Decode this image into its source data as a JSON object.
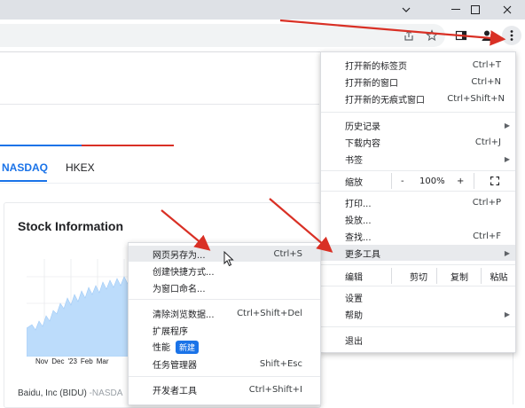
{
  "window": {
    "controls": [
      "chevron-down-icon",
      "minimize-icon",
      "maximize-icon",
      "close-icon"
    ]
  },
  "toolbar": {
    "icons": [
      "share-icon",
      "star-icon",
      "side-panel-icon",
      "profile-icon",
      "kebab-menu-icon"
    ]
  },
  "page": {
    "tabs": [
      {
        "label": "NASDAQ",
        "active": true
      },
      {
        "label": "HKEX",
        "active": false
      }
    ],
    "card_title": "Stock Information",
    "x_ticks": [
      "Nov",
      "Dec",
      "'23",
      "Feb",
      "Mar"
    ],
    "stock_name": "Baidu, Inc (BIDU)",
    "stock_exchange": "-NASDA"
  },
  "main_menu": {
    "items": [
      {
        "label": "打开新的标签页",
        "shortcut": "Ctrl+T"
      },
      {
        "label": "打开新的窗口",
        "shortcut": "Ctrl+N"
      },
      {
        "label": "打开新的无痕式窗口",
        "shortcut": "Ctrl+Shift+N"
      },
      {
        "label": "历史记录",
        "shortcut": ""
      },
      {
        "label": "下载内容",
        "shortcut": "Ctrl+J"
      },
      {
        "label": "书签",
        "shortcut": ""
      },
      {
        "label": "打印...",
        "shortcut": "Ctrl+P"
      },
      {
        "label": "投放...",
        "shortcut": ""
      },
      {
        "label": "查找...",
        "shortcut": "Ctrl+F"
      },
      {
        "label": "更多工具",
        "shortcut": ""
      },
      {
        "label": "设置",
        "shortcut": ""
      },
      {
        "label": "帮助",
        "shortcut": ""
      },
      {
        "label": "退出",
        "shortcut": ""
      }
    ],
    "zoom": {
      "label": "缩放",
      "minus": "-",
      "value": "100%",
      "plus": "+"
    },
    "edit": {
      "label": "编辑",
      "cut": "剪切",
      "copy": "复制",
      "paste": "粘贴"
    }
  },
  "submenu": {
    "items": [
      {
        "label": "网页另存为...",
        "shortcut": "Ctrl+S"
      },
      {
        "label": "创建快捷方式...",
        "shortcut": ""
      },
      {
        "label": "为窗口命名...",
        "shortcut": ""
      },
      {
        "label": "清除浏览数据...",
        "shortcut": "Ctrl+Shift+Del"
      },
      {
        "label": "扩展程序",
        "shortcut": ""
      },
      {
        "label": "性能",
        "shortcut": "",
        "badge": "新建"
      },
      {
        "label": "任务管理器",
        "shortcut": "Shift+Esc"
      },
      {
        "label": "开发者工具",
        "shortcut": "Ctrl+Shift+I"
      }
    ]
  },
  "colors": {
    "accent": "#1a73e8",
    "annotation_red": "#d93025",
    "chart_fill": "#bcdcfb",
    "menu_highlight": "#e8eaed"
  }
}
